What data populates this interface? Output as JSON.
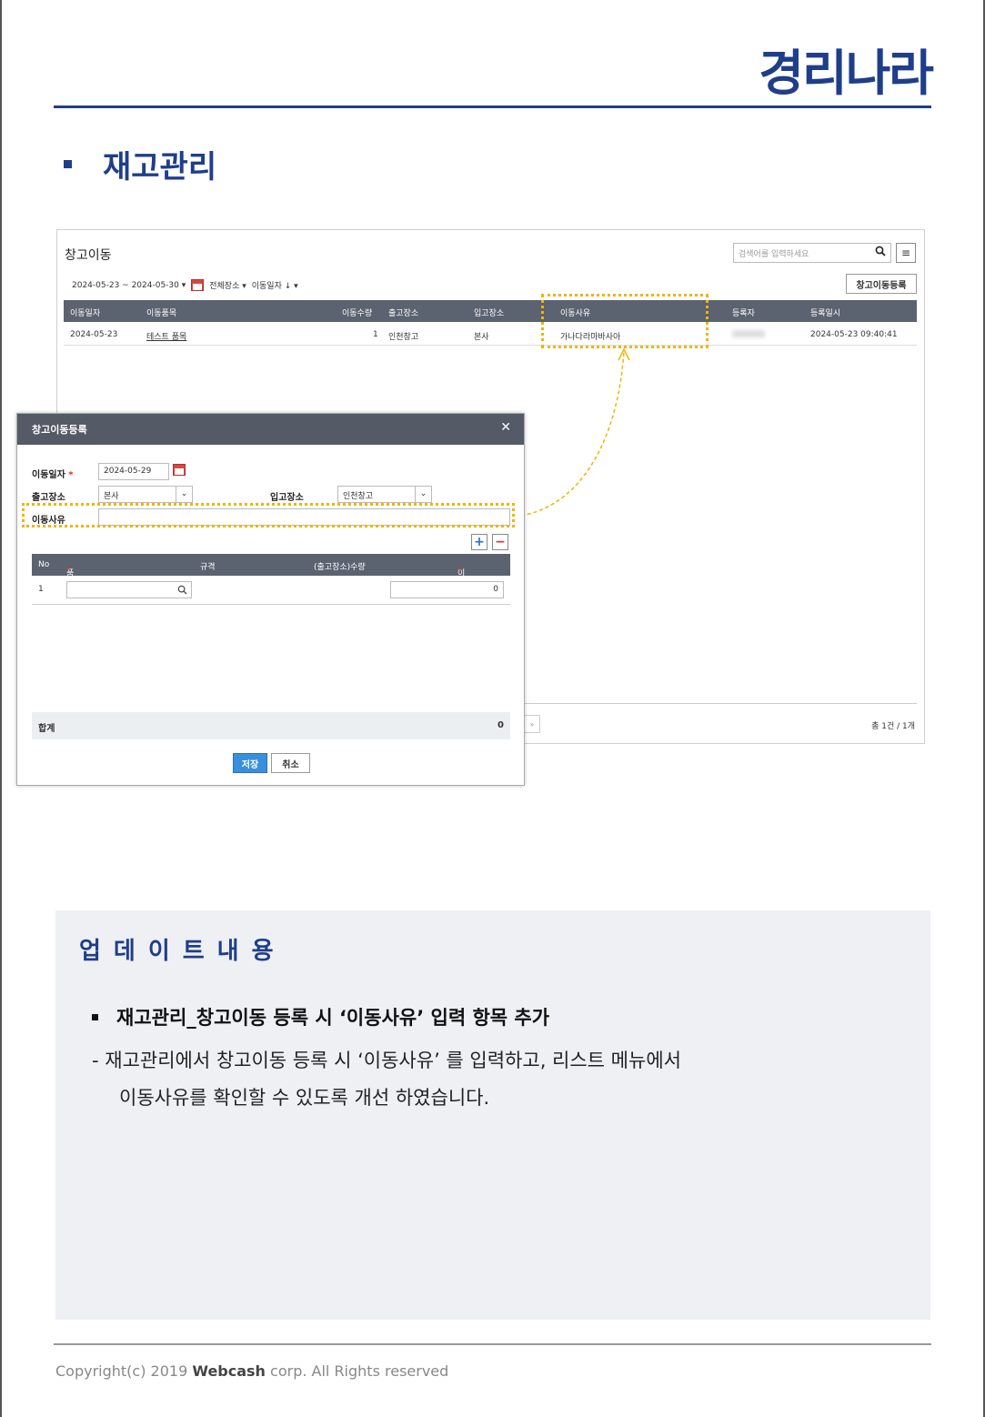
{
  "brand": {
    "logo": "경리나라",
    "color": "#1f3e8a"
  },
  "section": {
    "title": "재고관리"
  },
  "list": {
    "title": "창고이동",
    "search_placeholder": "검색어를 입력하세요",
    "date_range": "2024-05-23 ~ 2024-05-30 ▾",
    "location_filter": "전체장소 ▾",
    "sort_filter": "이동일자 ↓ ▾",
    "register_button": "창고이동등록",
    "columns": [
      "이동일자",
      "이동품목",
      "이동수량",
      "출고장소",
      "입고장소",
      "이동사유",
      "등록자",
      "등록일시"
    ],
    "rows": [
      {
        "date": "2024-05-23",
        "item": "테스트 품목",
        "qty": "1",
        "from": "인천창고",
        "to": "본사",
        "reason": "가나다라마바사아",
        "registered_at": "2024-05-23 09:40:41"
      }
    ],
    "total": "총 1건 / 1개",
    "pager_next": "»"
  },
  "dialog": {
    "title": "창고이동등록",
    "close": "✕",
    "date_label": "이동일자",
    "required_mark": "*",
    "date_value": "2024-05-29",
    "from_label": "출고장소",
    "from_value": "본사",
    "to_label": "입고장소",
    "to_value": "인천창고",
    "reason_label": "이동사유",
    "reason_value": "",
    "add": "+",
    "remove": "−",
    "columns": {
      "no": "No",
      "item": "품목",
      "spec": "규격",
      "stock": "(출고장소)수량",
      "qty": "이동수량"
    },
    "row": {
      "no": "1",
      "qty": "0"
    },
    "sum_label": "합계",
    "sum_value": "0",
    "save": "저장",
    "cancel": "취소"
  },
  "update": {
    "title": "업데이트내용",
    "headline": "재고관리_창고이동 등록 시 ‘이동사유’ 입력 항목 추가",
    "desc_line1": "- 재고관리에서 창고이동 등록 시 ‘이동사유’ 를 입력하고, 리스트 메뉴에서",
    "desc_line2": "이동사유를 확인할 수 있도록 개선 하였습니다."
  },
  "footer": {
    "prefix": "Copyright(c) 2019 ",
    "brand": "Webcash",
    "suffix": " corp. All Rights reserved"
  },
  "highlight_color": "#f0b400"
}
